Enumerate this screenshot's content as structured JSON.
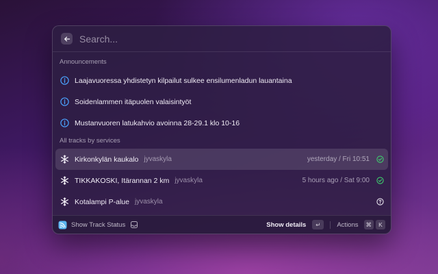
{
  "search": {
    "placeholder": "Search..."
  },
  "sections": {
    "announcements_title": "Announcements",
    "tracks_title": "All tracks by services"
  },
  "announcements": [
    {
      "title": "Laajavuoressa yhdistetyn kilpailut sulkee ensilumenladun lauantaina",
      "icon": "info-icon"
    },
    {
      "title": "Soidenlammen itäpuolen valaisintyöt",
      "icon": "info-icon"
    },
    {
      "title": "Mustanvuoren latukahvio avoinna 28-29.1 klo 10-16",
      "icon": "info-icon"
    }
  ],
  "tracks": [
    {
      "title": "Kirkonkylän kaukalo",
      "subtitle": "jyvaskyla",
      "accessory": "yesterday / Fri 10:51",
      "status": "open",
      "icon": "snowflake-icon",
      "selected": true
    },
    {
      "title": "TIKKAKOSKI, Itärannan 2 km",
      "subtitle": "jyvaskyla",
      "accessory": "5 hours ago / Sat 9:00",
      "status": "open",
      "icon": "snowflake-icon",
      "selected": false
    },
    {
      "title": "Kotalampi P-alue",
      "subtitle": "jyvaskyla",
      "accessory": "",
      "status": "unknown",
      "icon": "snowflake-icon",
      "selected": false
    }
  ],
  "footer": {
    "title": "Show Track Status",
    "primary_action": "Show details",
    "enter_key": "↵",
    "actions_label": "Actions",
    "cmd_key": "⌘",
    "k_key": "K"
  },
  "colors": {
    "info": "#4aa3ff",
    "status_open": "#3ecf6e",
    "status_unknown": "#e8e4ee",
    "accent_extension": "#5ab4f0"
  }
}
